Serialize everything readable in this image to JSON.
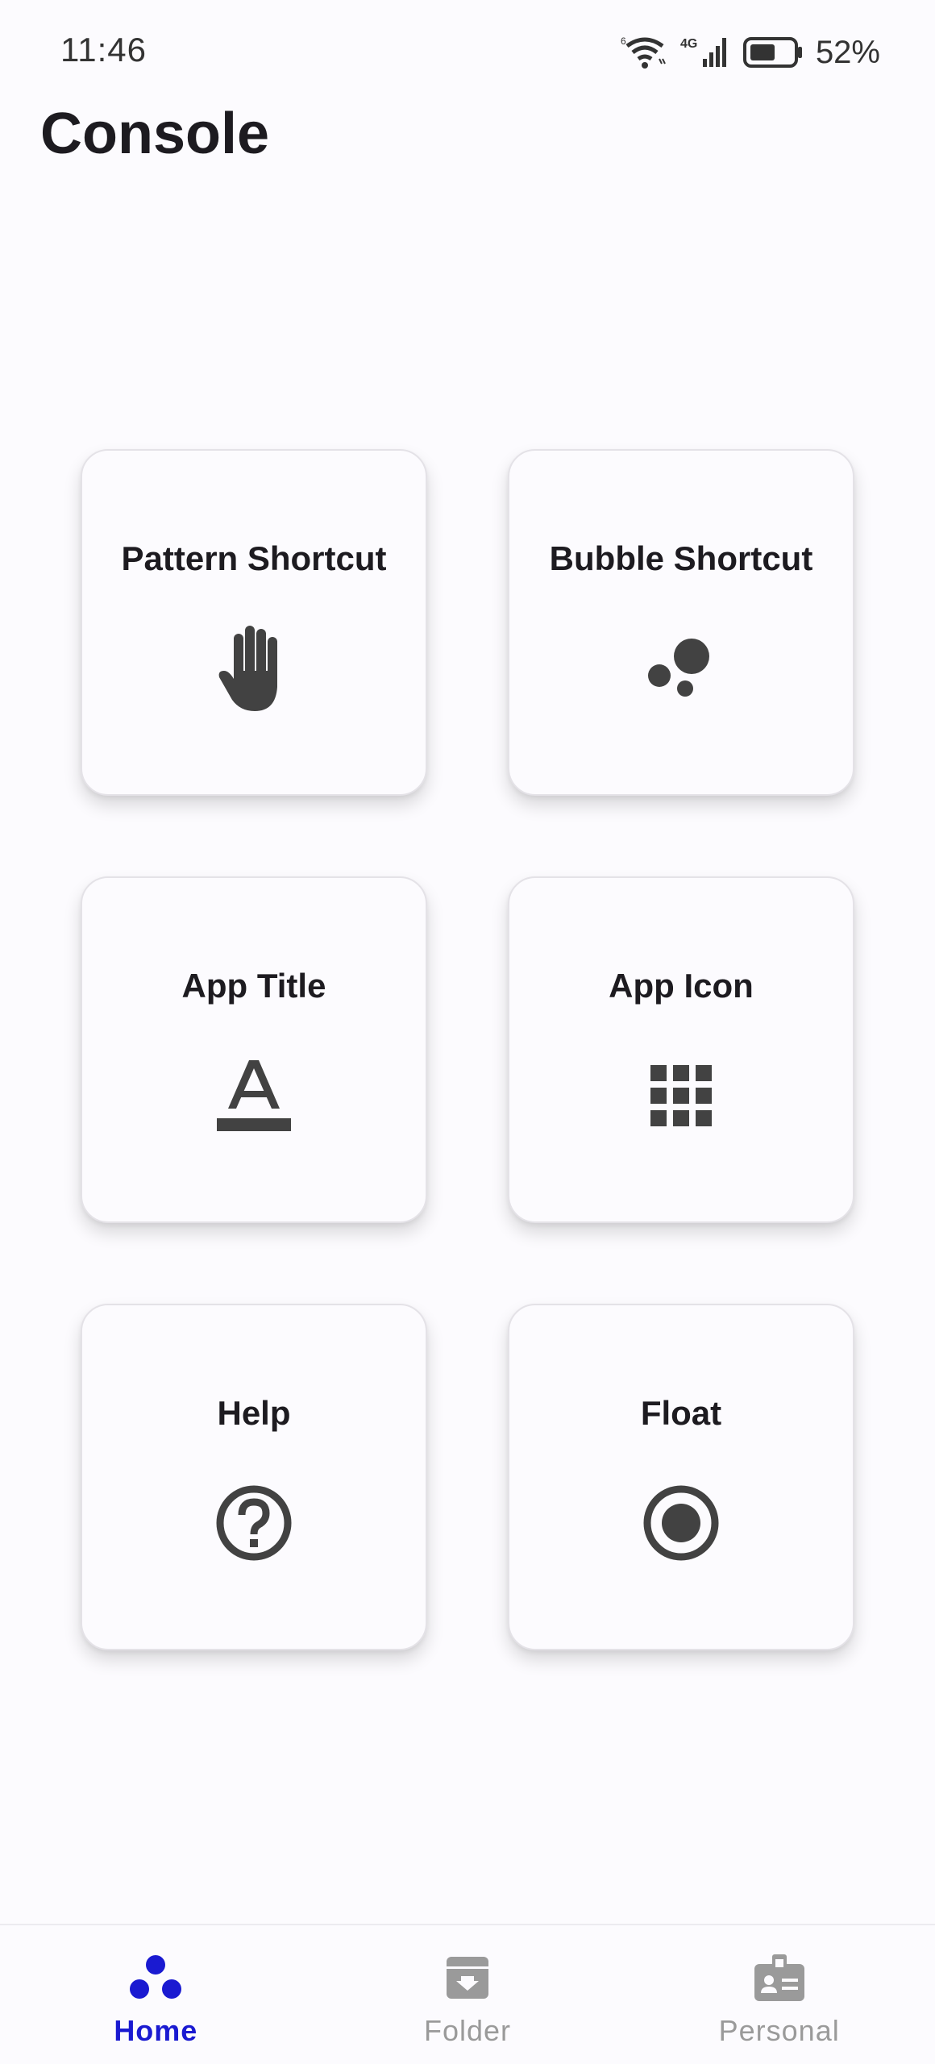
{
  "status_bar": {
    "time": "11:46",
    "network": "4G",
    "battery": "52%"
  },
  "page": {
    "title": "Console"
  },
  "cards": [
    {
      "label": "Pattern Shortcut",
      "icon": "hand-icon"
    },
    {
      "label": "Bubble Shortcut",
      "icon": "bubbles-icon"
    },
    {
      "label": "App Title",
      "icon": "text-format-icon"
    },
    {
      "label": "App Icon",
      "icon": "grid-apps-icon"
    },
    {
      "label": "Help",
      "icon": "help-icon"
    },
    {
      "label": "Float",
      "icon": "radio-button-icon"
    }
  ],
  "bottom_nav": {
    "items": [
      {
        "label": "Home",
        "icon": "home-dots-icon",
        "active": true
      },
      {
        "label": "Folder",
        "icon": "archive-icon",
        "active": false
      },
      {
        "label": "Personal",
        "icon": "badge-icon",
        "active": false
      }
    ]
  },
  "colors": {
    "accent": "#1a1ad1",
    "icon_dark": "#424242",
    "nav_inactive": "#9a9a9a",
    "background": "#fcfbfe"
  }
}
